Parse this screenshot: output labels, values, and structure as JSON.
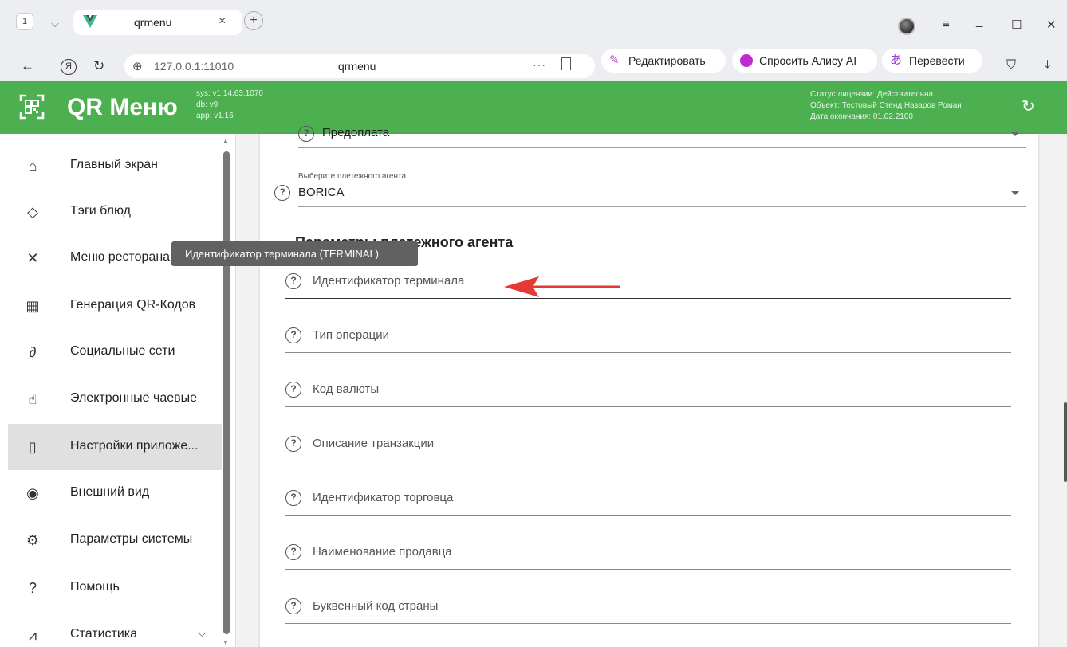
{
  "browser": {
    "tab_count": "1",
    "tab_title": "qrmenu",
    "url": "127.0.0.1:11010",
    "page_title": "qrmenu",
    "edit_label": "Редактировать",
    "alice_label": "Спросить Алису AI",
    "translate_label": "Перевести"
  },
  "header": {
    "brand": "QR Меню",
    "sys_version": "sys: v1.14.63.1070",
    "db_version": "db: v9",
    "app_version": "app: v1.16",
    "license_status": "Статус лицензии: Действительна",
    "license_object": "Объект: Тестовый Стенд Назаров Роман",
    "license_end": "Дата окончания: 01.02.2100",
    "accent_color": "#4caf50"
  },
  "sidebar": {
    "items": [
      {
        "label": "Главный экран",
        "icon": "home-icon"
      },
      {
        "label": "Тэги блюд",
        "icon": "tag-icon"
      },
      {
        "label": "Меню ресторана",
        "icon": "cutlery-icon"
      },
      {
        "label": "Генерация QR-Кодов",
        "icon": "qr-code-icon"
      },
      {
        "label": "Социальные сети",
        "icon": "link-icon"
      },
      {
        "label": "Электронные чаевые",
        "icon": "tip-hand-icon"
      },
      {
        "label": "Настройки приложе...",
        "icon": "app-settings-icon",
        "active": true
      },
      {
        "label": "Внешний вид",
        "icon": "eye-icon"
      },
      {
        "label": "Параметры системы",
        "icon": "gear-icon"
      },
      {
        "label": "Помощь",
        "icon": "help-icon"
      },
      {
        "label": "Статистика",
        "icon": "chart-icon"
      }
    ]
  },
  "form": {
    "prepay_value": "Предоплата",
    "agent_label": "Выберите плетежного агента",
    "agent_value": "BORICA",
    "section_title": "Параметры платежного агента",
    "fields": [
      {
        "label": "Идентификатор терминала"
      },
      {
        "label": "Тип операции"
      },
      {
        "label": "Код валюты"
      },
      {
        "label": "Описание транзакции"
      },
      {
        "label": "Идентификатор торговца"
      },
      {
        "label": "Наименование продавца"
      },
      {
        "label": "Буквенный код страны"
      }
    ]
  },
  "tooltip": {
    "text": "Идентификатор терминала (TERMINAL)"
  }
}
